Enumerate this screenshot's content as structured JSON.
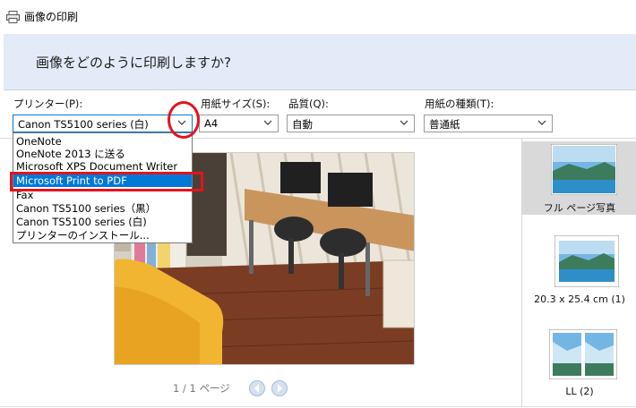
{
  "window": {
    "title": "画像の印刷",
    "icon": "printer-icon"
  },
  "banner": {
    "question": "画像をどのように印刷しますか?"
  },
  "printer": {
    "label": "プリンター(P):",
    "value": "Canon TS5100 series (白)"
  },
  "paper_size": {
    "label": "用紙サイズ(S):",
    "value": "A4"
  },
  "quality": {
    "label": "品質(Q):",
    "value": "自動"
  },
  "paper_type": {
    "label": "用紙の種類(T):",
    "value": "普通紙"
  },
  "printer_dropdown": {
    "items": [
      "OneNote",
      "OneNote 2013 に送る",
      "Microsoft XPS Document Writer",
      "Microsoft Print to PDF",
      "Fax",
      "Canon TS5100 series（黒）",
      "Canon TS5100 series (白)",
      "プリンターのインストール..."
    ],
    "highlighted_index": 3
  },
  "pager": {
    "text": "1 / 1 ページ"
  },
  "layouts": [
    {
      "caption": "フル ページ写真",
      "selected": true
    },
    {
      "caption": "20.3 x 25.4 cm (1)",
      "selected": false
    },
    {
      "caption": "LL (2)",
      "selected": false
    }
  ],
  "colors": {
    "accent": "#0078d7",
    "annotation": "#e3141c",
    "banner": "#e2ebf7"
  }
}
